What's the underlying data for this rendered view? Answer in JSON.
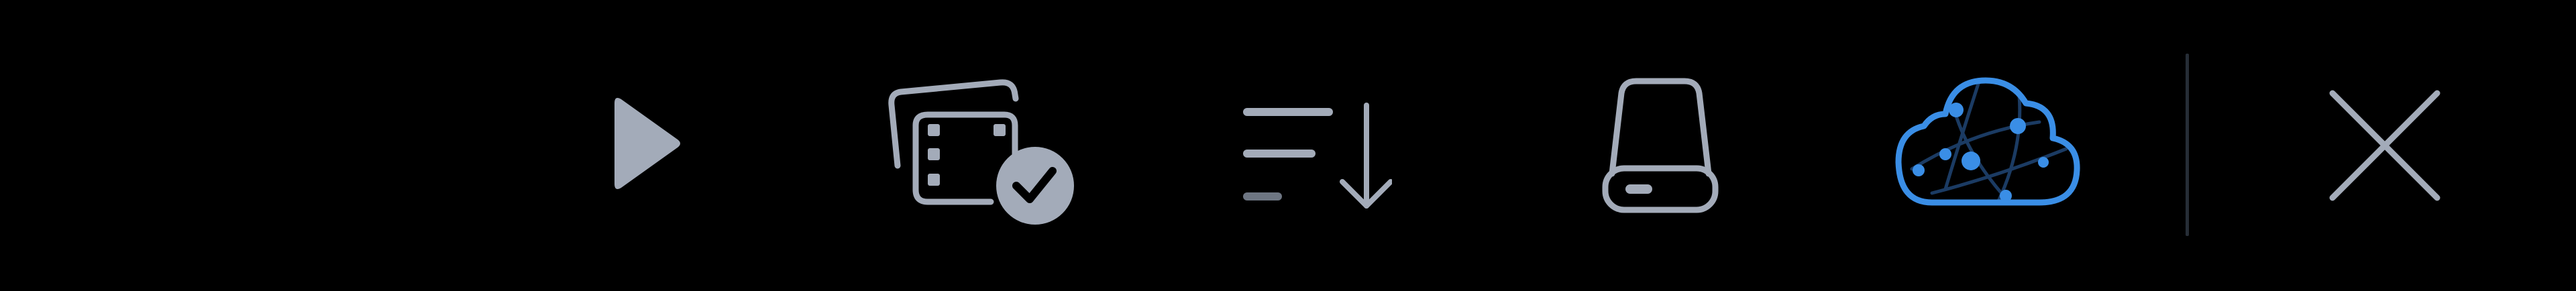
{
  "toolbar": {
    "buttons": [
      {
        "id": "play",
        "icon": "play-icon",
        "tooltip": ""
      },
      {
        "id": "media-library",
        "icon": "media-library-check-icon",
        "tooltip": ""
      },
      {
        "id": "sort",
        "icon": "sort-descending-icon",
        "tooltip": ""
      },
      {
        "id": "local-storage",
        "icon": "hard-drive-icon",
        "tooltip": ""
      },
      {
        "id": "cloud-network",
        "icon": "cloud-network-icon",
        "tooltip": "",
        "active": true
      },
      {
        "id": "close",
        "icon": "close-icon",
        "tooltip": ""
      }
    ]
  },
  "colors": {
    "background": "#000000",
    "icon": "#a3abb9",
    "icon_dim": "#6e7683",
    "accent": "#3a8ee6",
    "accent_dark": "#1b3b63",
    "divider": "#262d36"
  }
}
